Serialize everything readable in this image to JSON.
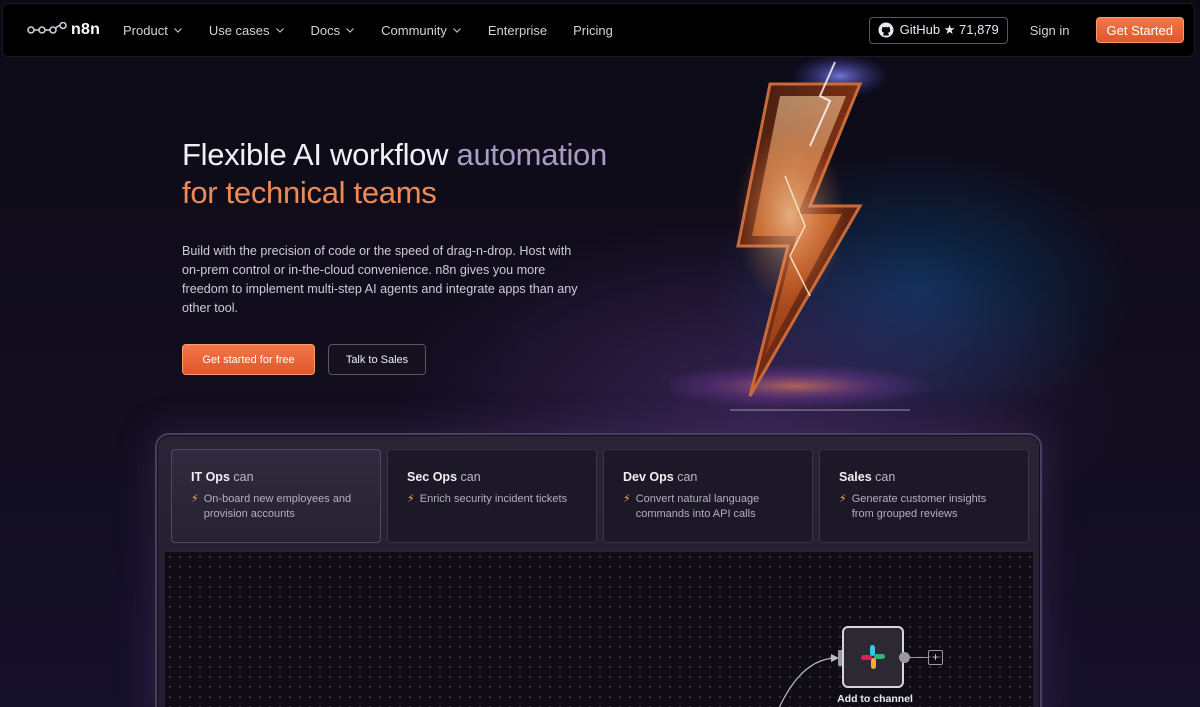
{
  "nav": {
    "logo_text": "n8n",
    "items": [
      {
        "label": "Product",
        "has_dropdown": true
      },
      {
        "label": "Use cases",
        "has_dropdown": true
      },
      {
        "label": "Docs",
        "has_dropdown": true
      },
      {
        "label": "Community",
        "has_dropdown": true
      },
      {
        "label": "Enterprise",
        "has_dropdown": false
      },
      {
        "label": "Pricing",
        "has_dropdown": false
      }
    ],
    "github_label": "GitHub ★ 71,879",
    "signin_label": "Sign in",
    "cta_label": "Get Started"
  },
  "hero": {
    "headline_part1": "Flexible AI workflow ",
    "headline_part2": "automation",
    "headline_part3": "for technical teams",
    "lead": "Build with the precision of code or the speed of drag-n-drop. Host with on-prem control or in-the-cloud convenience. n8n gives you more freedom to implement multi-step AI agents and integrate apps than any other tool.",
    "primary_cta": "Get started for free",
    "secondary_cta": "Talk to Sales"
  },
  "use_cases": [
    {
      "role": "IT Ops",
      "can": " can",
      "desc": "On-board new employees and provision accounts",
      "active": true
    },
    {
      "role": "Sec Ops",
      "can": " can",
      "desc": "Enrich security incident tickets",
      "active": false
    },
    {
      "role": "Dev Ops",
      "can": " can",
      "desc": "Convert natural language commands into API calls",
      "active": false
    },
    {
      "role": "Sales",
      "can": " can",
      "desc": "Generate customer insights from grouped reviews",
      "active": false
    }
  ],
  "workflow": {
    "slack_node_label": "Add to channel",
    "plus_symbol": "+",
    "bolt_symbol": "⚡"
  },
  "colors": {
    "accent": "#ee6b3e",
    "background": "#0e0b17",
    "headline_muted": "#a79dc4",
    "headline_orange": "#ef8a55"
  }
}
